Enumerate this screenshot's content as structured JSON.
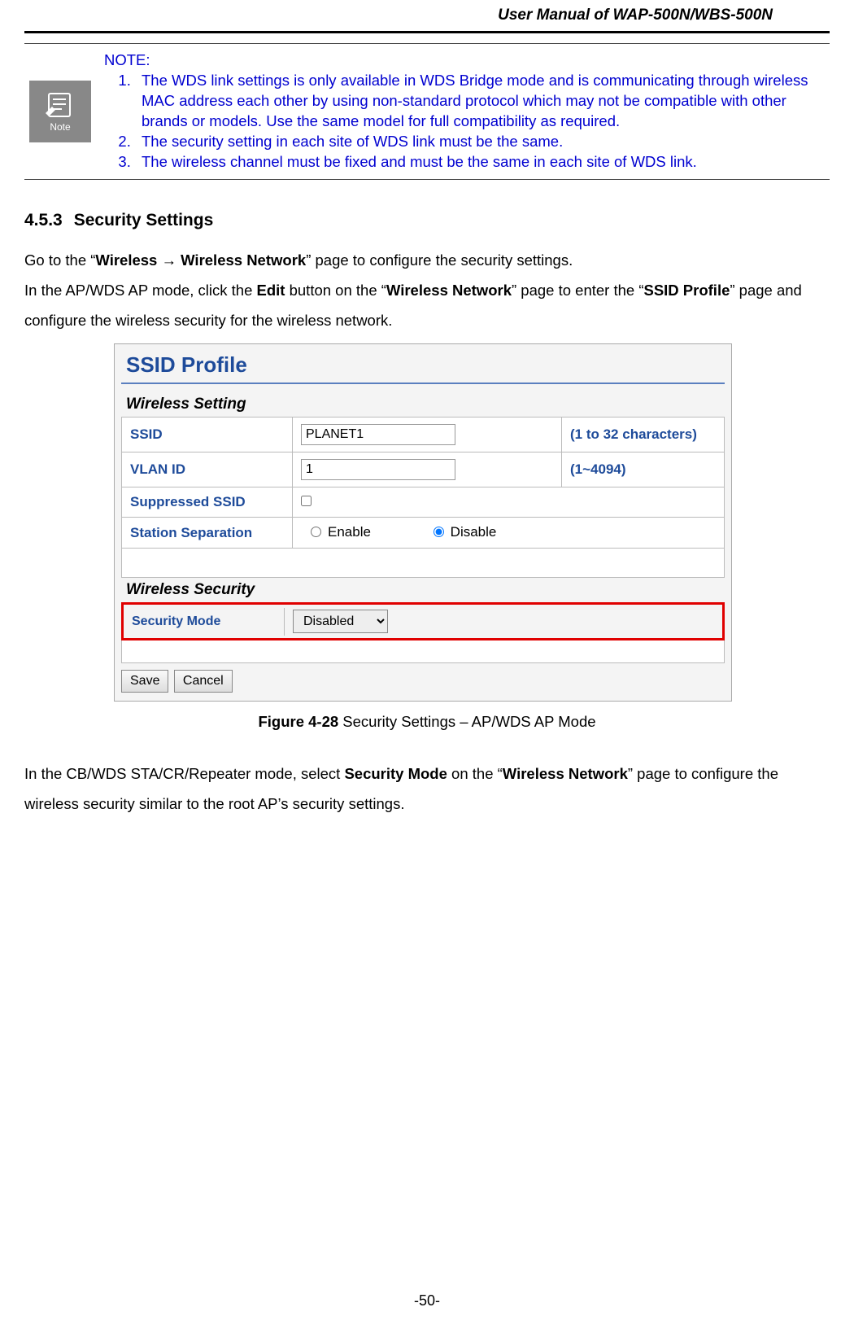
{
  "header": {
    "title": "User Manual of WAP-500N/WBS-500N"
  },
  "note": {
    "icon_label": "Note",
    "title": "NOTE:",
    "items": [
      "The WDS link settings is only available in WDS Bridge mode and is communicating through wireless MAC address each other by using non-standard protocol which may not be compatible with other brands or models. Use the same model for full compatibility as required.",
      "The security setting in each site of WDS link must be the same.",
      "The wireless channel must be fixed and must be the same in each site of WDS link."
    ]
  },
  "section": {
    "number": "4.5.3",
    "title": "Security Settings"
  },
  "para1": {
    "pre": "Go to the “",
    "bold1": "Wireless ",
    "arrow": "→",
    "bold2": " Wireless Network",
    "post": "” page to configure the security settings."
  },
  "para2": {
    "t1": "In the AP/WDS AP mode, click the ",
    "b1": "Edit",
    "t2": " button on the “",
    "b2": "Wireless Network",
    "t3": "” page to enter the “",
    "b3": "SSID Profile",
    "t4": "” page and configure the wireless security for the wireless network."
  },
  "figure": {
    "title": "SSID Profile",
    "wireless_setting_label": "Wireless Setting",
    "rows": {
      "ssid": {
        "label": "SSID",
        "value": "PLANET1",
        "hint": "(1 to 32 characters)"
      },
      "vlan": {
        "label": "VLAN ID",
        "value": "1",
        "hint": "(1~4094)"
      },
      "suppressed": {
        "label": "Suppressed SSID"
      },
      "station": {
        "label": "Station Separation",
        "enable": "Enable",
        "disable": "Disable"
      }
    },
    "wireless_security_label": "Wireless Security",
    "security_mode": {
      "label": "Security Mode",
      "value": "Disabled"
    },
    "buttons": {
      "save": "Save",
      "cancel": "Cancel"
    }
  },
  "figure_caption": {
    "bold": "Figure 4-28 ",
    "rest": "Security Settings – AP/WDS AP Mode"
  },
  "para3": {
    "t1": "In the CB/WDS STA/CR/Repeater mode, select ",
    "b1": "Security Mode",
    "t2": " on the “",
    "b2": "Wireless Network",
    "t3": "” page to configure the wireless security similar to the root AP’s security settings."
  },
  "footer": {
    "page": "-50-"
  }
}
